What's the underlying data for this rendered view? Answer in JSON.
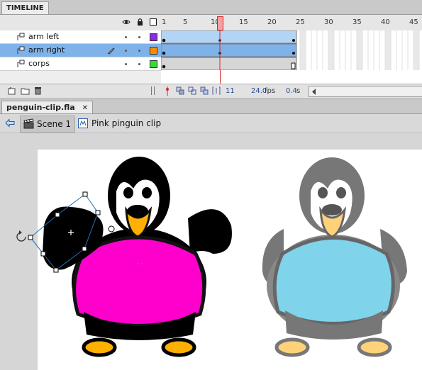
{
  "timeline": {
    "tab_label": "TIMELINE",
    "frame_numbers": [
      "1",
      "5",
      "10",
      "15",
      "20",
      "25",
      "30",
      "35",
      "40",
      "45"
    ],
    "layers": [
      {
        "name": "arm left",
        "color": "#8a2be2",
        "selected": false
      },
      {
        "name": "arm right",
        "color": "#ff8c00",
        "selected": true
      },
      {
        "name": "corps",
        "color": "#33dd33",
        "selected": false
      }
    ],
    "status": {
      "current_frame": "11",
      "fps_value": "24.0",
      "fps_unit": "fps",
      "time_value": "0.4",
      "time_unit": "s"
    }
  },
  "document": {
    "tab_label": "penguin-clip.fla",
    "close_glyph": "✕"
  },
  "breadcrumb": {
    "scene_label": "Scene 1",
    "symbol_label": "Pink pinguin clip"
  },
  "colors": {
    "playhead": "#e02020",
    "shirt_pink": "#ff00cc",
    "shirt_blue": "#7fd3ea",
    "feet_orange": "#ffb000",
    "selection_blue": "#7fb2e8"
  }
}
